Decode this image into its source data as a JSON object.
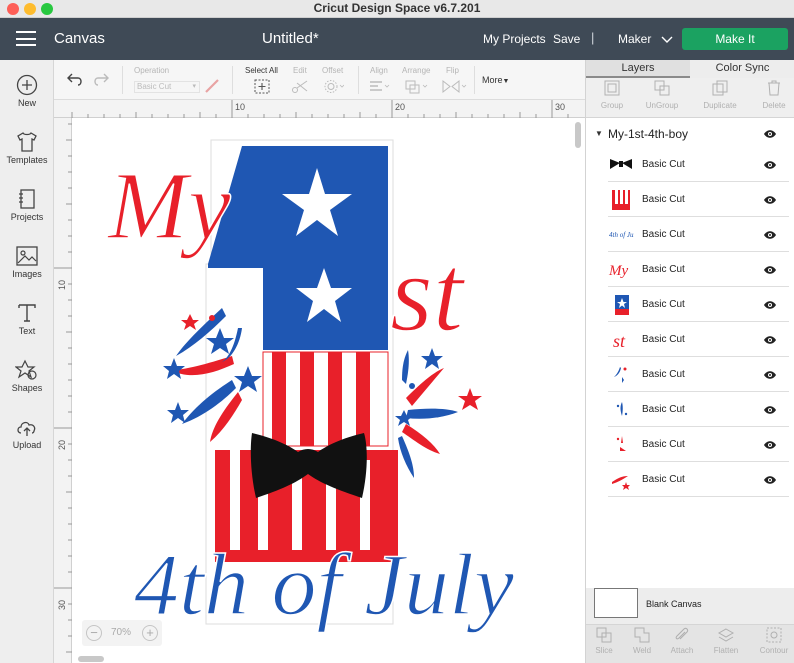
{
  "window": {
    "title": "Cricut Design Space  v6.7.201"
  },
  "header": {
    "app_name": "Canvas",
    "doc_title": "Untitled*",
    "my_projects": "My Projects",
    "save": "Save",
    "separator": "|",
    "machine": "Maker",
    "make_it": "Make It"
  },
  "sidebar": {
    "items": [
      {
        "label": "New",
        "icon": "plus-circle-icon"
      },
      {
        "label": "Templates",
        "icon": "shirt-icon"
      },
      {
        "label": "Projects",
        "icon": "notebook-icon"
      },
      {
        "label": "Images",
        "icon": "image-icon"
      },
      {
        "label": "Text",
        "icon": "text-icon"
      },
      {
        "label": "Shapes",
        "icon": "shapes-icon"
      },
      {
        "label": "Upload",
        "icon": "cloud-upload-icon"
      }
    ]
  },
  "toolbar": {
    "operation_label": "Operation",
    "operation_value": "Basic Cut",
    "select_all": "Select All",
    "edit": "Edit",
    "offset": "Offset",
    "align": "Align",
    "arrange": "Arrange",
    "flip": "Flip",
    "more": "More"
  },
  "ruler": {
    "top": [
      "10",
      "20",
      "30"
    ],
    "left": [
      "10",
      "20",
      "30"
    ]
  },
  "canvas": {
    "artwork": {
      "line1": "My",
      "line2": "st",
      "line3": "4th of July"
    },
    "zoom": {
      "minus": "−",
      "value": "70%",
      "plus": "+"
    }
  },
  "colors": {
    "red": "#e8202a",
    "blue": "#1f57b3",
    "black": "#111111",
    "make_it_green": "#1ba261",
    "header_bg": "#3f4a56"
  },
  "panel": {
    "tabs": [
      "Layers",
      "Color Sync"
    ],
    "actions": [
      "Group",
      "UnGroup",
      "Duplicate",
      "Delete"
    ],
    "group_name": "My-1st-4th-boy",
    "layers": [
      {
        "name": "Basic Cut",
        "thumb": "bowtie"
      },
      {
        "name": "Basic Cut",
        "thumb": "stripes"
      },
      {
        "name": "Basic Cut",
        "thumb": "text-blue"
      },
      {
        "name": "Basic Cut",
        "thumb": "my-red"
      },
      {
        "name": "Basic Cut",
        "thumb": "flag-stars"
      },
      {
        "name": "Basic Cut",
        "thumb": "st-red"
      },
      {
        "name": "Basic Cut",
        "thumb": "burst-blue-1"
      },
      {
        "name": "Basic Cut",
        "thumb": "burst-blue-2"
      },
      {
        "name": "Basic Cut",
        "thumb": "burst-red-1"
      },
      {
        "name": "Basic Cut",
        "thumb": "burst-red-2"
      }
    ],
    "blank_canvas": "Blank Canvas",
    "bottom_actions": [
      "Slice",
      "Weld",
      "Attach",
      "Flatten",
      "Contour"
    ]
  }
}
